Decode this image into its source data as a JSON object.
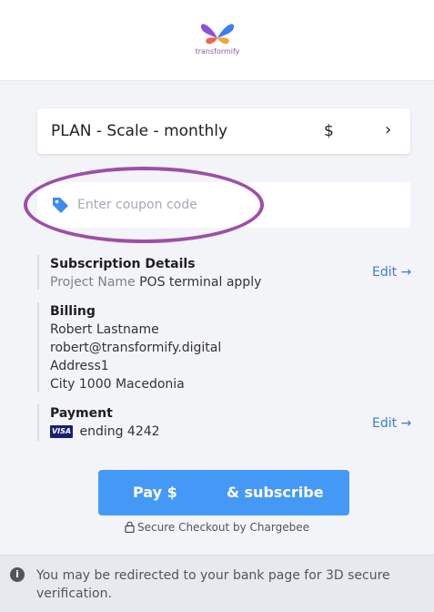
{
  "header": {
    "brand": "transformify"
  },
  "plan": {
    "name": "PLAN - Scale - monthly",
    "price": "$"
  },
  "coupon": {
    "placeholder": "Enter coupon code",
    "value": ""
  },
  "subscription_details": {
    "title": "Subscription Details",
    "field_label": "Project Name",
    "field_value": "POS terminal apply",
    "edit_label": "Edit →"
  },
  "billing": {
    "title": "Billing",
    "name": "Robert Lastname",
    "email": "robert@transformify.digital",
    "address": "Address1",
    "city_line": "City 1000 Macedonia"
  },
  "payment": {
    "title": "Payment",
    "card_brand": "VISA",
    "card_text": "ending 4242",
    "edit_label": "Edit →"
  },
  "pay_button": {
    "left": "Pay $",
    "right": "& subscribe"
  },
  "secure_text": "Secure Checkout by Chargebee",
  "note": "You may be redirected to your bank page for 3D secure verification.",
  "colors": {
    "accent": "#4599f6",
    "link": "#3d7ad6",
    "highlight": "#9c4fa8"
  }
}
